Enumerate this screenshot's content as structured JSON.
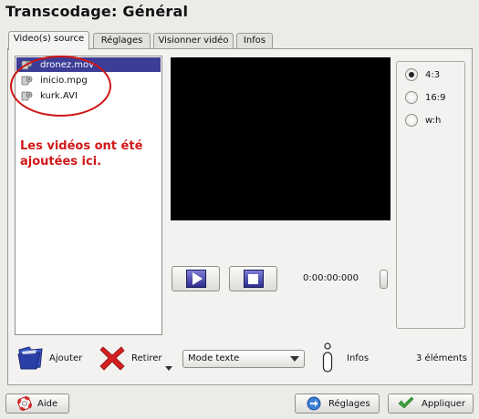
{
  "window": {
    "title": "Transcodage: Général"
  },
  "tabs": [
    {
      "label": "Video(s) source",
      "active": true
    },
    {
      "label": "Réglages",
      "active": false
    },
    {
      "label": "Visionner vidéo",
      "active": false
    },
    {
      "label": "Infos",
      "active": false
    }
  ],
  "files": [
    {
      "name": "dronez.mov",
      "icon": "video-file-icon",
      "selected": true
    },
    {
      "name": "inicio.mpg",
      "icon": "video-file-icon",
      "selected": false
    },
    {
      "name": "kurk.AVI",
      "icon": "video-file-icon",
      "selected": false
    }
  ],
  "annotation": {
    "text": "Les vidéos ont été ajoutées ici.",
    "color": "#d01818"
  },
  "player": {
    "play_icon": "play-icon",
    "stop_icon": "stop-icon",
    "time": "0:00:00:000"
  },
  "aspect_ratios": [
    {
      "label": "4:3",
      "selected": true
    },
    {
      "label": "16:9",
      "selected": false
    },
    {
      "label": "w:h",
      "selected": false
    }
  ],
  "toolbar": {
    "add_label": "Ajouter",
    "remove_label": "Retirer",
    "mode_select_value": "Mode texte",
    "info_label": "Infos",
    "count": "3 éléments"
  },
  "footer": {
    "help_label": "Aide",
    "settings_label": "Réglages",
    "apply_label": "Appliquer"
  },
  "colors": {
    "selection": "#3c3d96",
    "annotation": "#d01515",
    "remove_icon": "#d42020",
    "apply_check": "#3aa63a"
  }
}
